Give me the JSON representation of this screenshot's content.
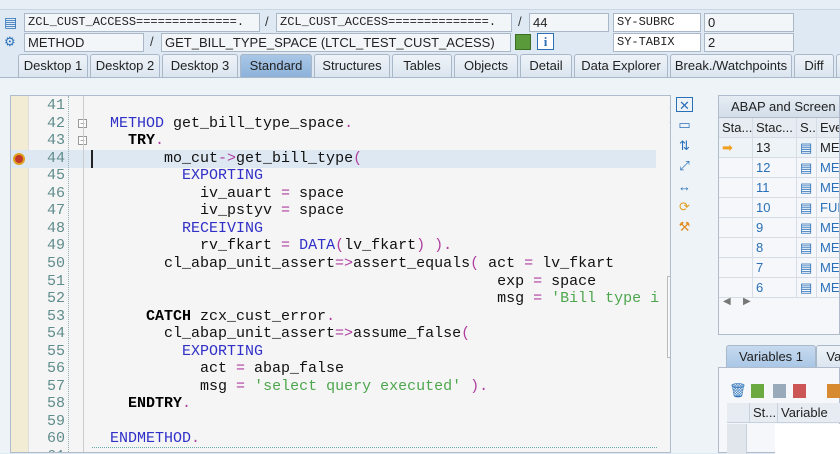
{
  "header": {
    "row1": {
      "program": "ZCL_CUST_ACCESS==============.",
      "include": "ZCL_CUST_ACCESS==============.",
      "line": "44",
      "sysvar": "SY-SUBRC",
      "sysval": "0"
    },
    "row2": {
      "event_type": "METHOD",
      "event": "GET_BILL_TYPE_SPACE (LTCL_TEST_CUST_ACESS)",
      "sysvar": "SY-TABIX",
      "sysval": "2"
    },
    "separator": "/"
  },
  "tabs": [
    {
      "label": "Desktop 1"
    },
    {
      "label": "Desktop 2"
    },
    {
      "label": "Desktop 3"
    },
    {
      "label": "Standard",
      "active": true
    },
    {
      "label": "Structures"
    },
    {
      "label": "Tables"
    },
    {
      "label": "Objects"
    },
    {
      "label": "Detail"
    },
    {
      "label": "Data Explorer"
    },
    {
      "label": "Break./Watchpoints"
    },
    {
      "label": "Diff"
    },
    {
      "label": "S"
    }
  ],
  "code": {
    "current_line": 44,
    "lines": [
      {
        "n": "41",
        "t": []
      },
      {
        "n": "42",
        "t": [
          [
            "  ",
            "p"
          ],
          [
            "METHOD",
            "kw"
          ],
          [
            " get_bill_type_space",
            "p"
          ],
          [
            ".",
            "op"
          ]
        ]
      },
      {
        "n": "43",
        "t": [
          [
            "    ",
            "p"
          ],
          [
            "TRY",
            "b"
          ],
          [
            ".",
            "op"
          ]
        ]
      },
      {
        "n": "44",
        "t": [
          [
            "        mo_cut",
            "p"
          ],
          [
            "->",
            "op"
          ],
          [
            "get_bill_type",
            "p"
          ],
          [
            "(",
            "op"
          ]
        ]
      },
      {
        "n": "45",
        "t": [
          [
            "          ",
            "p"
          ],
          [
            "EXPORTING",
            "kw"
          ]
        ]
      },
      {
        "n": "46",
        "t": [
          [
            "            iv_auart ",
            "p"
          ],
          [
            "=",
            "op"
          ],
          [
            " space",
            "p"
          ]
        ]
      },
      {
        "n": "47",
        "t": [
          [
            "            iv_pstyv ",
            "p"
          ],
          [
            "=",
            "op"
          ],
          [
            " space",
            "p"
          ]
        ]
      },
      {
        "n": "48",
        "t": [
          [
            "          ",
            "p"
          ],
          [
            "RECEIVING",
            "kw"
          ]
        ]
      },
      {
        "n": "49",
        "t": [
          [
            "            rv_fkart ",
            "p"
          ],
          [
            "=",
            "op"
          ],
          [
            " ",
            "p"
          ],
          [
            "DATA",
            "kw"
          ],
          [
            "(",
            "op"
          ],
          [
            "lv_fkart",
            "p"
          ],
          [
            ") ).",
            "op"
          ]
        ]
      },
      {
        "n": "50",
        "t": [
          [
            "        cl_abap_unit_assert",
            "p"
          ],
          [
            "=>",
            "op"
          ],
          [
            "assert_equals",
            "p"
          ],
          [
            "(",
            "op"
          ],
          [
            " act ",
            "p"
          ],
          [
            "=",
            "op"
          ],
          [
            " lv_fkart",
            "p"
          ]
        ]
      },
      {
        "n": "51",
        "t": [
          [
            "                                             exp ",
            "p"
          ],
          [
            "=",
            "op"
          ],
          [
            " space",
            "p"
          ]
        ]
      },
      {
        "n": "52",
        "t": [
          [
            "                                             msg ",
            "p"
          ],
          [
            "=",
            "op"
          ],
          [
            " ",
            "p"
          ],
          [
            "'Bill type i",
            "str"
          ]
        ]
      },
      {
        "n": "53",
        "t": [
          [
            "      ",
            "p"
          ],
          [
            "CATCH",
            "b"
          ],
          [
            " zcx_cust_error",
            "p"
          ],
          [
            ".",
            "op"
          ]
        ]
      },
      {
        "n": "54",
        "t": [
          [
            "        cl_abap_unit_assert",
            "p"
          ],
          [
            "=>",
            "op"
          ],
          [
            "assume_false",
            "p"
          ],
          [
            "(",
            "op"
          ]
        ]
      },
      {
        "n": "55",
        "t": [
          [
            "          ",
            "p"
          ],
          [
            "EXPORTING",
            "kw"
          ]
        ]
      },
      {
        "n": "56",
        "t": [
          [
            "            act ",
            "p"
          ],
          [
            "=",
            "op"
          ],
          [
            " abap_false",
            "p"
          ]
        ]
      },
      {
        "n": "57",
        "t": [
          [
            "            msg ",
            "p"
          ],
          [
            "=",
            "op"
          ],
          [
            " ",
            "p"
          ],
          [
            "'select query executed'",
            "str"
          ],
          [
            " ).",
            "op"
          ]
        ]
      },
      {
        "n": "58",
        "t": [
          [
            "    ",
            "p"
          ],
          [
            "ENDTRY",
            "b"
          ],
          [
            ".",
            "op"
          ]
        ]
      },
      {
        "n": "59",
        "t": []
      },
      {
        "n": "60",
        "t": [
          [
            "  ",
            "p"
          ],
          [
            "ENDMETHOD",
            "kw"
          ],
          [
            ".",
            "op"
          ]
        ]
      },
      {
        "n": "61",
        "t": []
      }
    ]
  },
  "stack": {
    "title": "ABAP and Screen St",
    "columns": [
      "Sta...",
      "Stac...",
      "S..",
      "Ever"
    ],
    "rows": [
      {
        "level": "13",
        "event": "MET",
        "current": true
      },
      {
        "level": "12",
        "event": "MET"
      },
      {
        "level": "11",
        "event": "MET"
      },
      {
        "level": "10",
        "event": "FUN"
      },
      {
        "level": "9",
        "event": "MET"
      },
      {
        "level": "8",
        "event": "MET"
      },
      {
        "level": "7",
        "event": "MET"
      },
      {
        "level": "6",
        "event": "MET"
      }
    ]
  },
  "variables": {
    "tabs": [
      "Variables 1",
      "Var"
    ],
    "columns": [
      "St...",
      "Variable"
    ]
  },
  "colors": {
    "keyword": "#3030c8",
    "operator": "#b040a0",
    "string": "#4da64d",
    "active_tab": "#8db2da",
    "link_blue": "#2a70b8"
  }
}
